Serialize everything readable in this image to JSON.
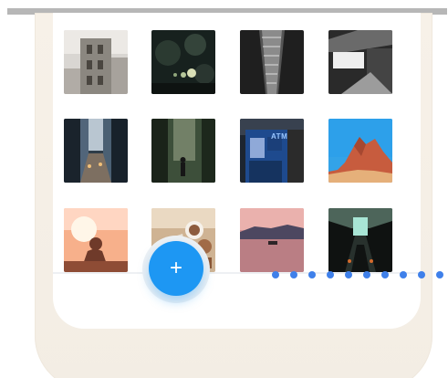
{
  "app": {
    "title": ""
  },
  "gallery": {
    "photos": [
      {
        "id": "old-building-facade-photo"
      },
      {
        "id": "dark-bokeh-photo"
      },
      {
        "id": "tower-structure-photo"
      },
      {
        "id": "modern-architecture-photo"
      },
      {
        "id": "city-street-photo"
      },
      {
        "id": "forest-walk-photo"
      },
      {
        "id": "atm-kiosk-photo"
      },
      {
        "id": "red-rock-photo"
      },
      {
        "id": "sunset-person-photo"
      },
      {
        "id": "cozy-coffee-photo"
      },
      {
        "id": "sea-sunset-photo"
      },
      {
        "id": "tunnel-light-photo"
      }
    ],
    "atm_text": "ATM"
  },
  "fab": {
    "label": "+",
    "color": "#1d97f3"
  },
  "indicator": {
    "dot_color": "#3f80ea"
  }
}
